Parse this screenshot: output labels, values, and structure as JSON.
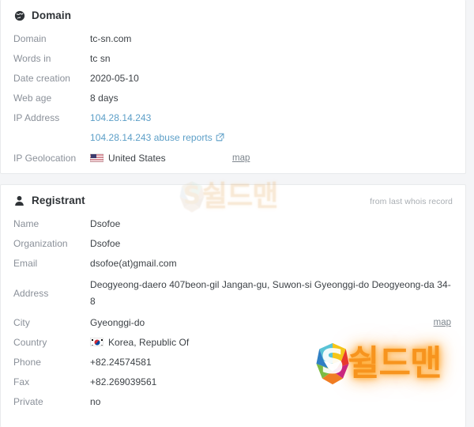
{
  "domain_card": {
    "icon": "globe-icon",
    "title": "Domain",
    "rows": [
      {
        "label": "Domain",
        "value": "tc-sn.com"
      },
      {
        "label": "Words in",
        "value": "tc sn"
      },
      {
        "label": "Date creation",
        "value": "2020-05-10"
      },
      {
        "label": "Web age",
        "value": "8 days"
      },
      {
        "label": "IP Address",
        "value": "104.28.14.243",
        "value2": "104.28.14.243 abuse reports"
      },
      {
        "label": "IP Geolocation",
        "value": "United States",
        "flag": "us-flag-icon",
        "map": "map"
      }
    ],
    "abuse_link_icon": "external-link-icon"
  },
  "registrant_card": {
    "icon": "user-icon",
    "title": "Registrant",
    "note": "from last whois record",
    "rows": [
      {
        "label": "Name",
        "value": "Dsofoe"
      },
      {
        "label": "Organization",
        "value": "Dsofoe"
      },
      {
        "label": "Email",
        "value": "dsofoe(at)gmail.com"
      },
      {
        "label": "Address",
        "value": "Deogyeong-daero 407beon-gil Jangan-gu, Suwon-si Gyeonggi-do Deogyeong-da 34-8"
      },
      {
        "label": "City",
        "value": "Gyeonggi-do",
        "map": "map"
      },
      {
        "label": "Country",
        "value": "Korea, Republic Of",
        "flag": "kr-flag-icon"
      },
      {
        "label": "Phone",
        "value": "+82.24574581"
      },
      {
        "label": "Fax",
        "value": "+82.269039561"
      },
      {
        "label": "Private",
        "value": "no"
      }
    ]
  },
  "watermarks": {
    "faded": {
      "logo": "shieldman-s-logo",
      "text": "쉴드맨"
    },
    "bright": {
      "logo": "shieldman-s-logo",
      "text": "쉴드맨"
    }
  },
  "colors": {
    "link": "#5b9ec7",
    "label": "#8a9099",
    "value": "#3c4146",
    "card_bg": "#ffffff",
    "page_bg": "#f4f5f7",
    "watermark_orange": "#f7941e"
  }
}
